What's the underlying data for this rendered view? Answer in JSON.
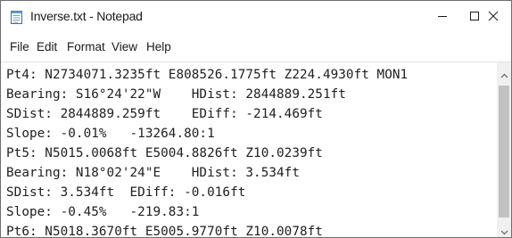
{
  "window": {
    "title": "Inverse.txt - Notepad",
    "app_icon": "notepad-icon",
    "controls": {
      "minimize_icon": "minimize-icon",
      "maximize_icon": "maximize-icon",
      "close_icon": "close-icon"
    }
  },
  "menu": {
    "items": [
      "File",
      "Edit",
      "Format",
      "View",
      "Help"
    ]
  },
  "editor": {
    "lines": [
      "Pt4: N2734071.3235ft E808526.1775ft Z224.4930ft MON1",
      "Bearing: S16°24'22\"W    HDist: 2844889.251ft",
      "SDist: 2844889.259ft    EDiff: -214.469ft",
      "Slope: -0.01%   -13264.80:1",
      "Pt5: N5015.0068ft E5004.8826ft Z10.0239ft",
      "Bearing: N18°02'24\"E    HDist: 3.534ft",
      "SDist: 3.534ft  EDiff: -0.016ft",
      "Slope: -0.45%   -219.83:1",
      "Pt6: N5018.3670ft E5005.9770ft Z10.0078ft"
    ]
  },
  "scrollbar": {
    "up_icon": "scroll-up-arrow-icon",
    "down_icon": "scroll-down-arrow-icon"
  },
  "colors": {
    "text": "#202020",
    "background": "#ffffff",
    "scroll_track": "#f0f0f0",
    "scroll_thumb": "#c2c2c2"
  }
}
